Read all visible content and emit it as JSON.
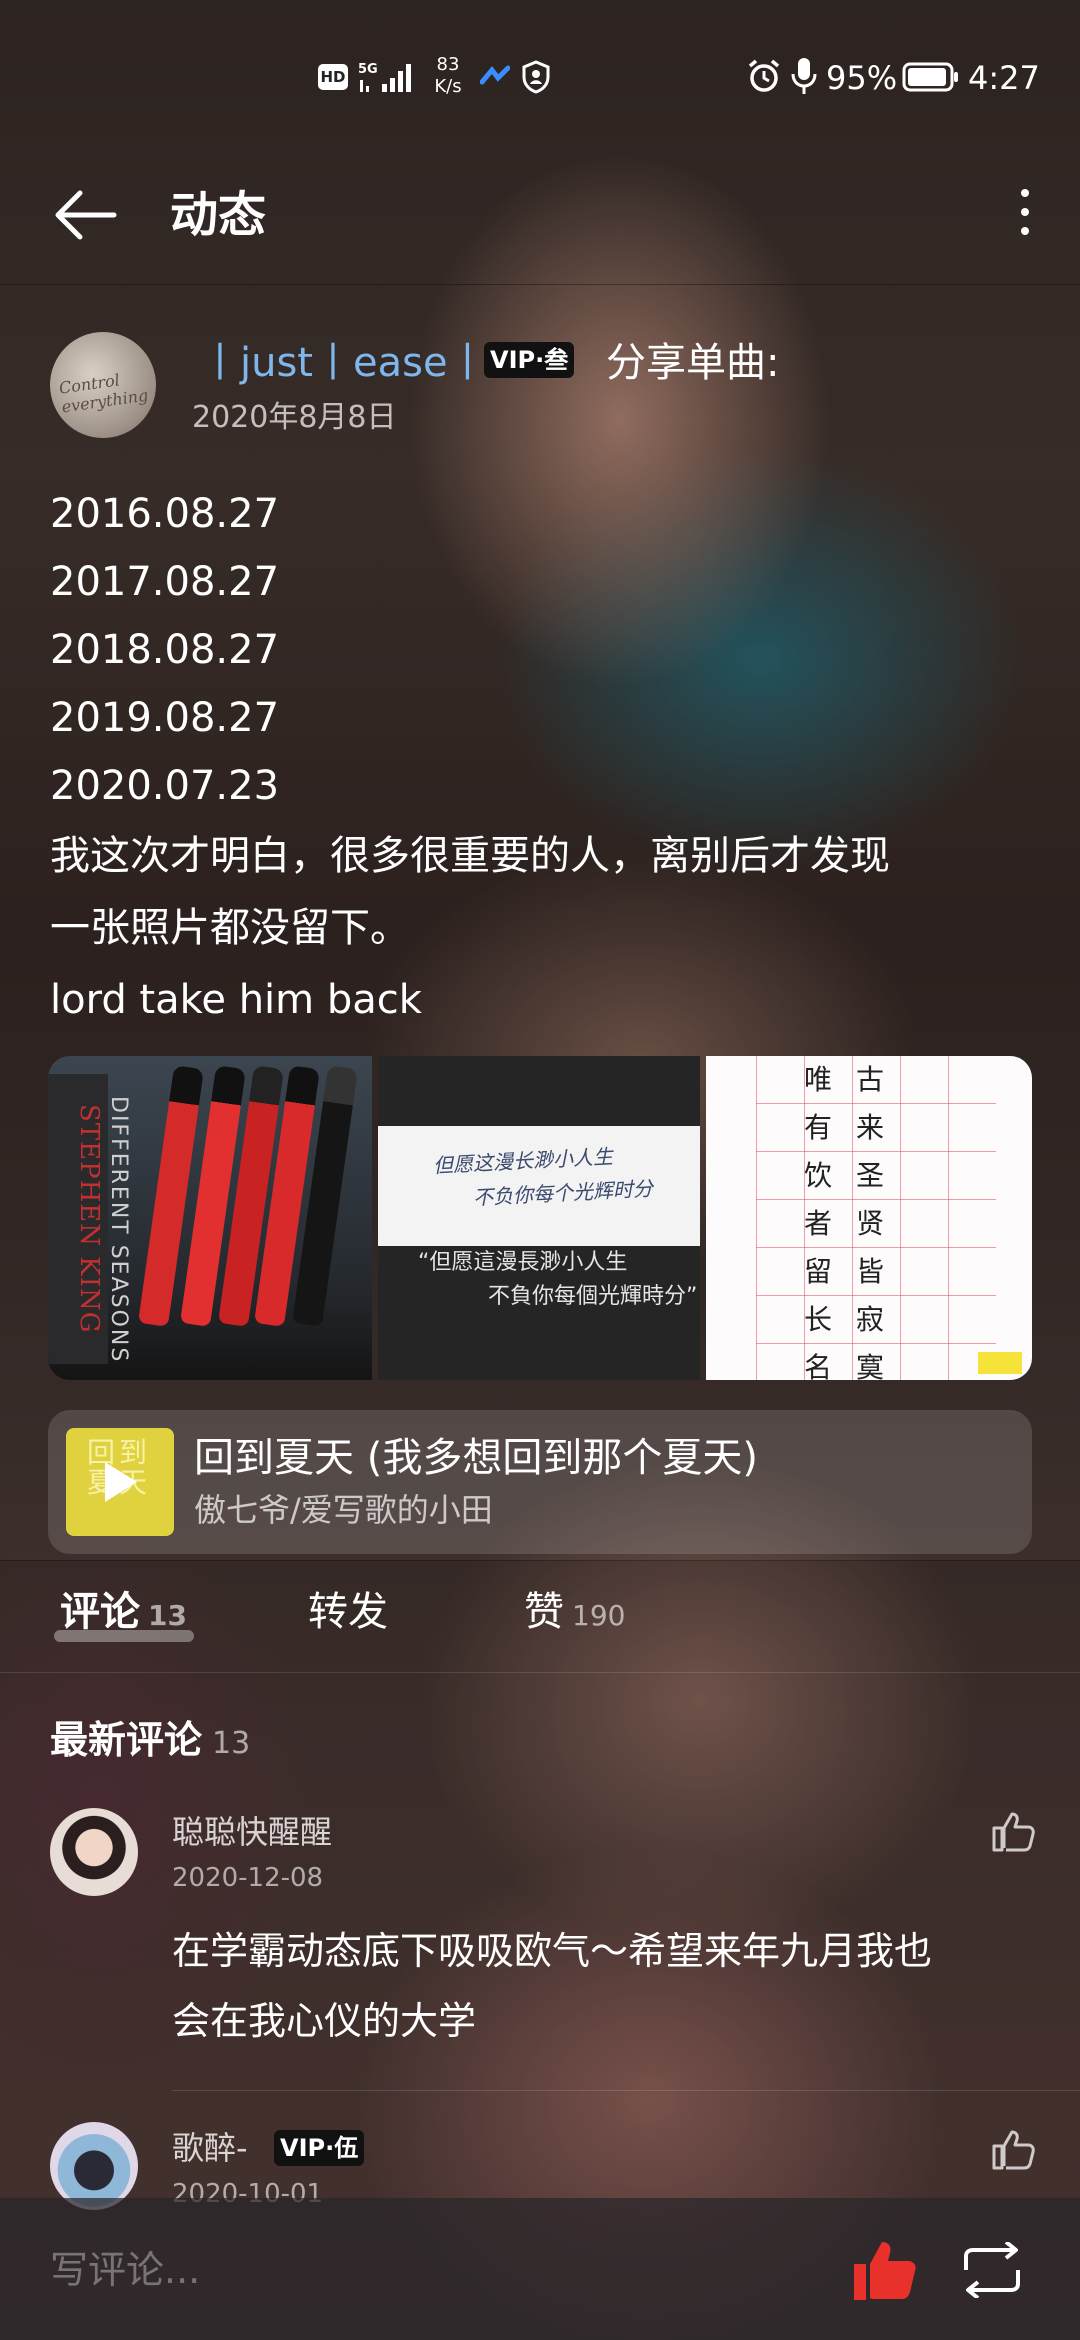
{
  "status_bar": {
    "hd": "HD",
    "network": "5G",
    "speed_value": "83",
    "speed_unit": "K/s",
    "battery": "95%",
    "time": "4:27"
  },
  "header": {
    "title": "动态"
  },
  "post": {
    "username": "丨just丨ease丨",
    "vip_badge": "VIP·叁",
    "share_label": "分享单曲:",
    "date": "2020年8月8日",
    "dates": [
      "2016.08.27",
      "2017.08.27",
      "2018.08.27",
      "2019.08.27",
      "2020.07.23"
    ],
    "text_lines": [
      "我这次才明白，很多很重要的人，离别后才发现",
      "一张照片都没留下。",
      "lord take him back"
    ],
    "image2": {
      "handwriting_line1": "但愿这漫长渺小人生",
      "handwriting_line2": "不负你每个光辉时分",
      "caption_line1": "“但愿這漫長渺小人生",
      "caption_line2": "不負你每個光輝時分”"
    },
    "image3": {
      "col1": [
        "唯",
        "有",
        "饮",
        "者",
        "留",
        "长",
        "名"
      ],
      "col2": [
        "古",
        "来",
        "圣",
        "贤",
        "皆",
        "寂",
        "寞"
      ]
    }
  },
  "song": {
    "title": "回到夏天 (我多想回到那个夏天)",
    "artist": "傲七爷/爱写歌的小田"
  },
  "tabs": {
    "comments_label": "评论",
    "comments_count": "13",
    "reposts_label": "转发",
    "likes_label": "赞",
    "likes_count": "190"
  },
  "latest": {
    "label": "最新评论",
    "count": "13"
  },
  "comments": [
    {
      "name": "聪聪快醒醒",
      "date": "2020-12-08",
      "text_line1": "在学霸动态底下吸吸欧气～希望来年九月我也",
      "text_line2": "会在我心仪的大学"
    },
    {
      "name": "歌醉-",
      "vip_badge": "VIP·伍",
      "date": "2020-10-01"
    }
  ],
  "bottom_bar": {
    "comment_placeholder": "写评论..."
  },
  "colors": {
    "username": "#7fb6ee",
    "like_red": "#e8312b",
    "song_cover": "#e0d23e"
  }
}
